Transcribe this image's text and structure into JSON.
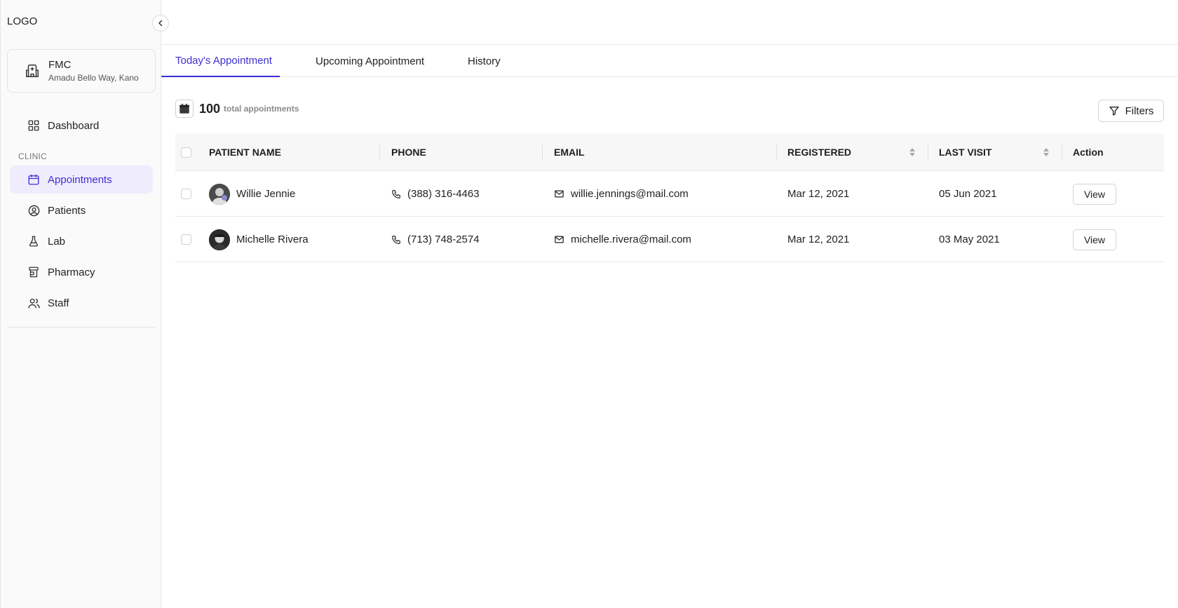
{
  "sidebar": {
    "logo": "LOGO",
    "clinic": {
      "name": "FMC",
      "address": "Amadu Bello Way, Kano"
    },
    "dashboard": {
      "label": "Dashboard",
      "icon": "grid-icon"
    },
    "section_label": "CLINIC",
    "items": [
      {
        "label": "Appointments",
        "icon": "calendar-icon",
        "active": true
      },
      {
        "label": "Patients",
        "icon": "user-circle-icon"
      },
      {
        "label": "Lab",
        "icon": "flask-icon"
      },
      {
        "label": "Pharmacy",
        "icon": "pill-bottle-icon"
      },
      {
        "label": "Staff",
        "icon": "users-icon"
      }
    ]
  },
  "tabs": [
    {
      "label": "Today's Appointment",
      "active": true
    },
    {
      "label": "Upcoming Appointment"
    },
    {
      "label": "History"
    }
  ],
  "summary": {
    "count": "100",
    "label": "total appointments"
  },
  "filters_label": "Filters",
  "table": {
    "headers": {
      "patient_name": "PATIENT NAME",
      "phone": "PHONE",
      "email": "EMAIL",
      "registered": "REGISTERED",
      "last_visit": "LAST VISIT",
      "action": "Action"
    },
    "rows": [
      {
        "name": "Willie Jennie",
        "phone": "(388) 316-4463",
        "email": "willie.jennings@mail.com",
        "registered": "Mar 12, 2021",
        "last_visit": "05 Jun 2021",
        "action": "View"
      },
      {
        "name": "Michelle Rivera",
        "phone": "(713) 748-2574",
        "email": "michelle.rivera@mail.com",
        "registered": "Mar 12, 2021",
        "last_visit": "03 May 2021",
        "action": "View"
      }
    ]
  },
  "colors": {
    "accent": "#3b2fd3",
    "active_bg": "#efecfd"
  }
}
